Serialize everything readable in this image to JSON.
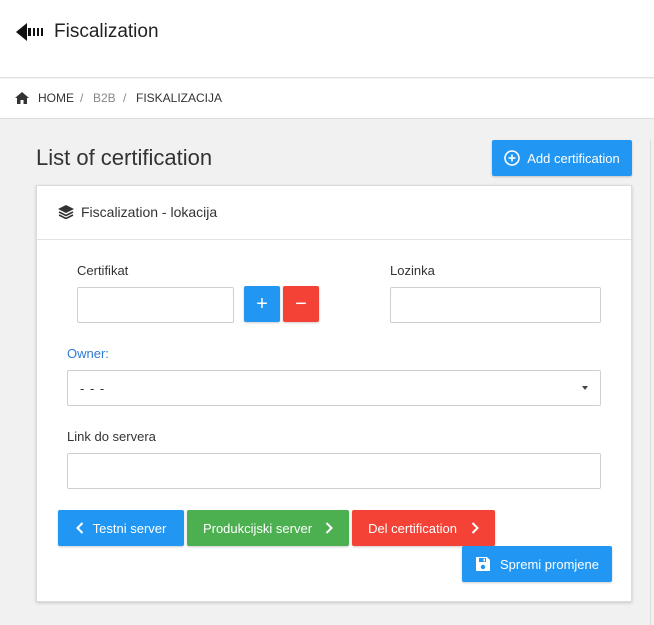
{
  "header": {
    "title": "Fiscalization"
  },
  "breadcrumb": {
    "items": [
      "HOME",
      "B2B",
      "FISKALIZACIJA"
    ],
    "separator": "/"
  },
  "page": {
    "title": "List of certification",
    "add_button_label": "Add certification"
  },
  "panel": {
    "title": "Fiscalization - lokacija",
    "certifikat": {
      "label": "Certifikat",
      "value": "",
      "placeholder": ""
    },
    "lozinka": {
      "label": "Lozinka",
      "value": "",
      "placeholder": ""
    },
    "owner": {
      "label": "Owner:",
      "selected": "- - -"
    },
    "link": {
      "label": "Link do servera",
      "value": "",
      "placeholder": ""
    },
    "buttons": {
      "add": "+",
      "remove": "−",
      "testni": "Testni server",
      "produkcijski": "Produkcijski server",
      "del": "Del certification",
      "spremi": "Spremi promjene"
    }
  },
  "icons": {
    "back": "arrow-back-icon",
    "home": "home-icon",
    "add": "plus-circle-icon",
    "layers": "layers-icon",
    "chevron_left": "chevron-left-icon",
    "chevron_right": "chevron-right-icon",
    "save": "floppy-icon"
  },
  "colors": {
    "primary": "#2196f3",
    "success": "#4caf50",
    "danger": "#f44336",
    "accent_label": "#2d7cd6"
  }
}
